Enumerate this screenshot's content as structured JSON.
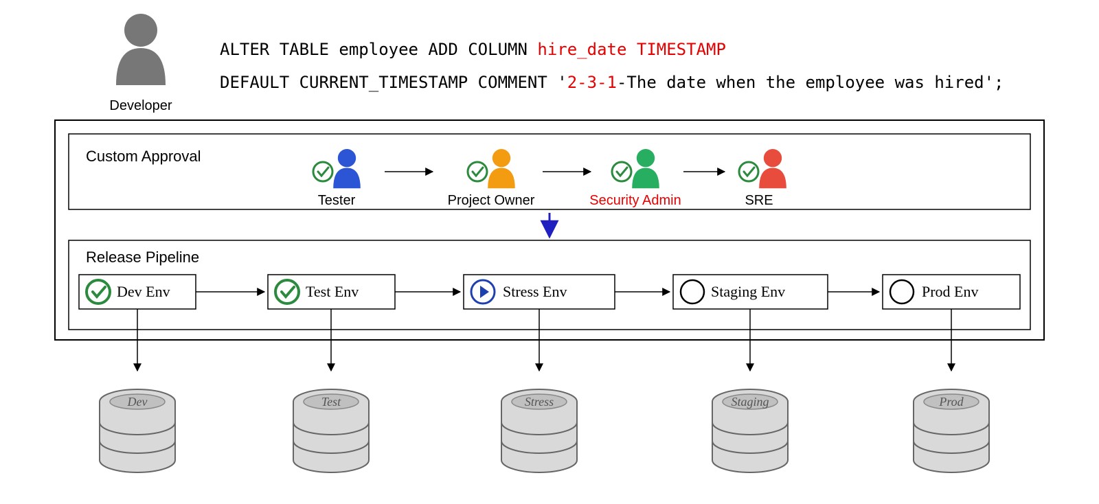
{
  "dev_role": "Developer",
  "sql_l1_a": "ALTER TABLE employee ADD COLUMN ",
  "sql_l1_b": "hire_date TIMESTAMP",
  "sql_l2_a": "DEFAULT CURRENT_TIMESTAMP COMMENT '",
  "sql_l2_b": "2-3-1",
  "sql_l2_c": "-The date when the employee was hired';",
  "section_approval": "Custom Approval",
  "section_pipeline": "Release Pipeline",
  "approvers": [
    "Tester",
    "Project Owner",
    "Security Admin",
    "SRE"
  ],
  "envs": [
    "Dev Env",
    "Test Env",
    "Stress Env",
    "Staging Env",
    "Prod Env"
  ],
  "dbs": [
    "Dev",
    "Test",
    "Stress",
    "Staging",
    "Prod"
  ]
}
